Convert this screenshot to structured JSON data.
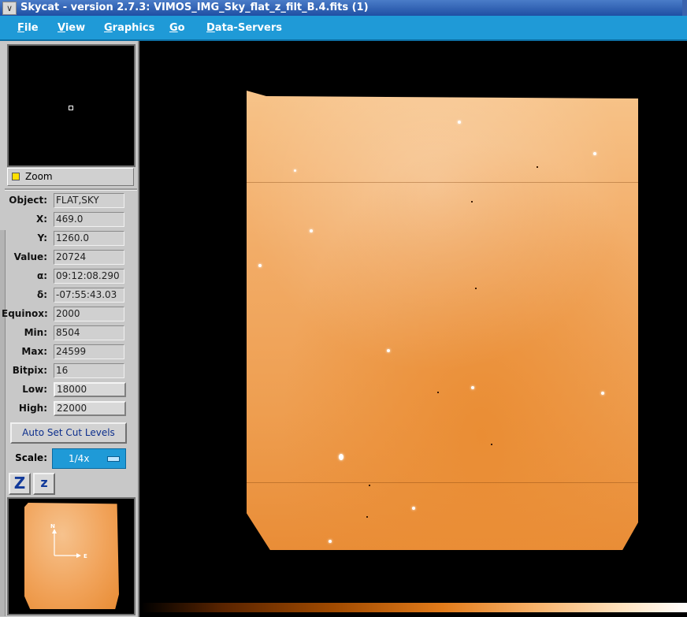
{
  "window": {
    "title": "Skycat - version 2.7.3: VIMOS_IMG_Sky_flat_z_filt_B.4.fits (1)",
    "sys_glyph": "∨"
  },
  "menu": [
    {
      "first": "F",
      "rest": "ile"
    },
    {
      "first": "V",
      "rest": "iew"
    },
    {
      "first": "G",
      "rest": "raphics"
    },
    {
      "first": "G",
      "rest": "o"
    },
    {
      "first": "D",
      "rest": "ata-Servers"
    }
  ],
  "zoom": {
    "label": "Zoom"
  },
  "info": {
    "object": {
      "label": "Object:",
      "value": "FLAT,SKY"
    },
    "x": {
      "label": "X:",
      "value": "469.0"
    },
    "y": {
      "label": "Y:",
      "value": "1260.0"
    },
    "value": {
      "label": "Value:",
      "value": "20724"
    },
    "alpha": {
      "label": "α:",
      "value": "09:12:08.290"
    },
    "delta": {
      "label": "δ:",
      "value": "-07:55:43.03"
    },
    "equinox": {
      "label": "Equinox:",
      "value": "2000"
    },
    "min": {
      "label": "Min:",
      "value": "8504"
    },
    "max": {
      "label": "Max:",
      "value": "24599"
    },
    "bitpix": {
      "label": "Bitpix:",
      "value": "16"
    },
    "low": {
      "label": "Low:",
      "value": "18000"
    },
    "high": {
      "label": "High:",
      "value": "22000"
    }
  },
  "auto_cut_label": "Auto Set Cut Levels",
  "scale": {
    "label": "Scale:",
    "value": "1/4x"
  },
  "zoom_buttons": {
    "zoom_in": "Z",
    "zoom_out": "z"
  },
  "compass": {
    "north": "N",
    "east": "E"
  },
  "colors": {
    "menu_bar": "#1f9ad7",
    "image_orange": "#f2ac67",
    "highlight": "#ffe000"
  }
}
